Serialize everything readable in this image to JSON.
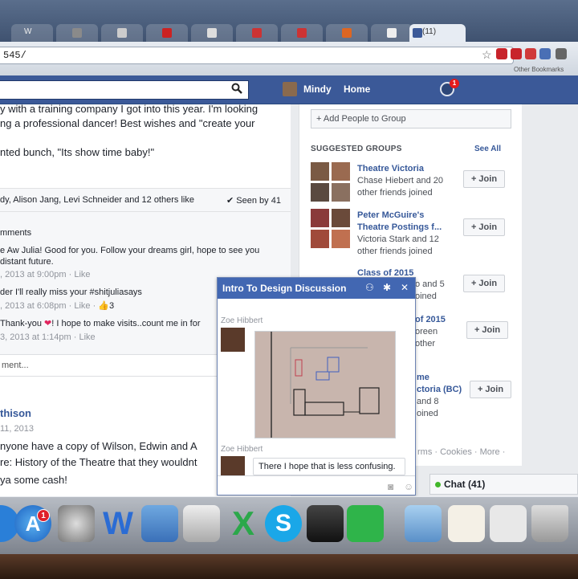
{
  "browser": {
    "tabs": [
      {
        "label": "W",
        "color": "#888888"
      },
      {
        "label": "",
        "color": "#8a8a8a"
      },
      {
        "label": "",
        "color": "#cccccc"
      },
      {
        "label": "",
        "color": "#cc2222"
      },
      {
        "label": "",
        "color": "#dddddd"
      },
      {
        "label": "",
        "color": "#cc3333"
      },
      {
        "label": "",
        "color": "#cc3333"
      },
      {
        "label": "",
        "color": "#dd6622"
      },
      {
        "label": "",
        "color": "#eeeeee"
      }
    ],
    "active_tab_label": "(11)",
    "url": "545/",
    "bookmark_label": "Other Bookmarks"
  },
  "fb_bar": {
    "user_name": "Mindy",
    "home_label": "Home",
    "notification_count": "1",
    "search_icon": "search-icon",
    "notification_icon": "globe-icon"
  },
  "feed": {
    "post1_lines": [
      "y with a training company I got into this year. I'm looking",
      "ng a professional dancer! Best wishes and \"create your",
      "",
      "nted bunch, \"Its show time baby!\""
    ],
    "likes_text": "dy, Alison Jang, Levi Schneider and 12 others like",
    "seen_text": "Seen by 41",
    "comments_label": "mments",
    "comments": [
      {
        "text": "e Aw Julia! Good for you. Follow your dreams girl, hope to see you",
        "continued": "distant future.",
        "meta": ", 2013 at 9:00pm · Like"
      },
      {
        "text": "der I'll really miss your #shitjuliasays",
        "meta": ", 2013 at 6:08pm · Like · ",
        "likes": "3"
      },
      {
        "text": "Thank-you ",
        "text_after": "! I hope to make visits..count me in for",
        "meta": "3, 2013 at 1:14pm · Like"
      }
    ],
    "write_comment_placeholder": "ment...",
    "post2_author": "thison",
    "post2_date": "11, 2013",
    "post2_lines": [
      "nyone have a copy of Wilson, Edwin and A",
      "re: History of the Theatre that they wouldnt",
      "ya some cash!"
    ]
  },
  "sidebar": {
    "add_people_label": "+ Add People to Group",
    "suggested_title": "SUGGESTED GROUPS",
    "see_all": "See All",
    "join_label": "+ Join",
    "groups": [
      {
        "name": "Theatre Victoria",
        "lines": [
          "Chase Hiebert and 20",
          "other friends joined"
        ]
      },
      {
        "name": "Peter McGuire's",
        "name2": "Theatre Postings f...",
        "lines": [
          "Victoria Stark and 12",
          "other friends joined"
        ]
      },
      {
        "name": "Class of 2015",
        "lines": [
          "o and 5",
          "oined"
        ]
      },
      {
        "name": "of 2015",
        "lines": [
          "oreen",
          "other"
        ]
      },
      {
        "name": "me",
        "name2": "ctoria (BC)",
        "lines": [
          "and 8",
          "oined"
        ]
      }
    ],
    "footer_links": "rms · Cookies · More ·",
    "chat_label": "Chat (41)"
  },
  "chat_window": {
    "title": "Intro To Design Discussion",
    "sender_1": "Zoe Hibbert",
    "sender_2": "Zoe Hibbert",
    "message": "There I hope that is less confusing.",
    "icons": [
      "add-friend-icon",
      "settings-icon",
      "close-icon"
    ]
  },
  "dock": {
    "app_store_badge": "1",
    "items": [
      "finder-icon",
      "app-store-icon",
      "system-preferences-icon",
      "word-icon",
      "image-capture-icon",
      "iphoto-icon",
      "excel-icon",
      "skype-icon",
      "final-cut-icon",
      "evernote-icon",
      "downloads-folder-icon",
      "documents-stack-icon",
      "stack-icon",
      "trash-icon"
    ]
  }
}
